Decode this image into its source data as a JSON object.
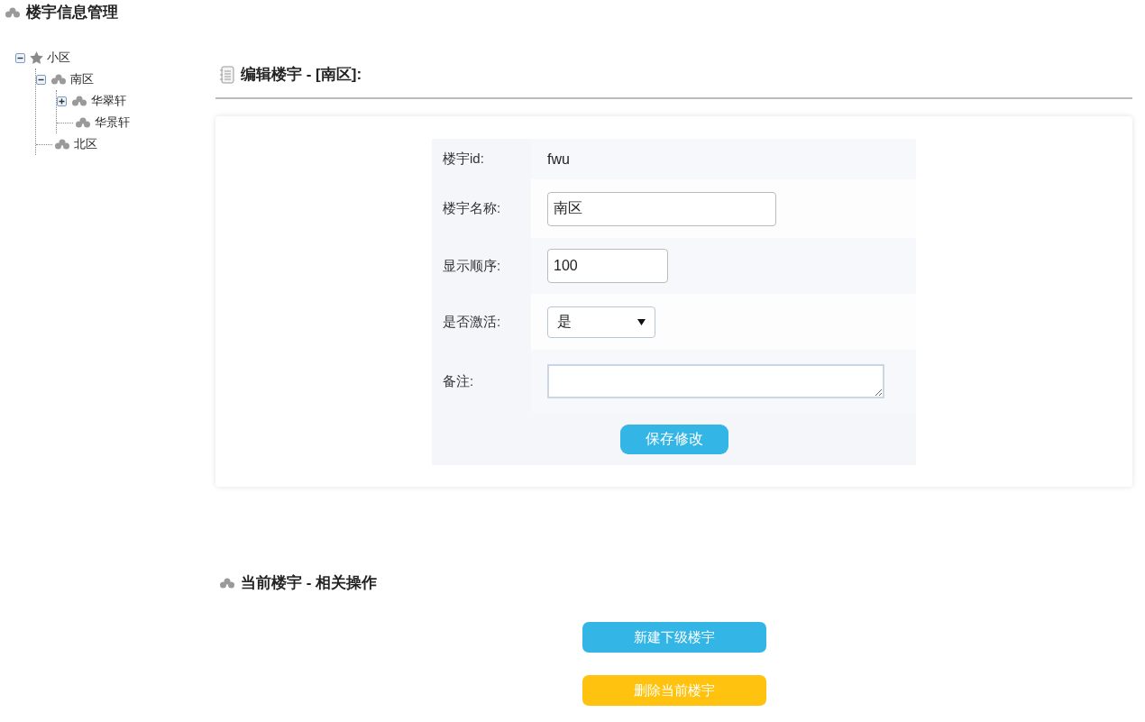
{
  "page_title": "楼宇信息管理",
  "tree": [
    {
      "label": "小区",
      "kind": "root",
      "expanded": true,
      "children": [
        {
          "label": "南区",
          "kind": "building",
          "expanded": true,
          "children": [
            {
              "label": "华翠轩",
              "kind": "building",
              "expanded": false
            },
            {
              "label": "华景轩",
              "kind": "building"
            }
          ]
        },
        {
          "label": "北区",
          "kind": "building"
        }
      ]
    }
  ],
  "edit_section": {
    "title": "编辑楼宇 - [南区]:",
    "fields": [
      {
        "kind": "text",
        "label": "楼宇id:",
        "value": "fwu"
      },
      {
        "kind": "input",
        "label": "楼宇名称:",
        "value": "南区"
      },
      {
        "kind": "short_input",
        "label": "显示顺序:",
        "value": "100"
      },
      {
        "kind": "select",
        "label": "是否激活:",
        "value": "是"
      },
      {
        "kind": "textarea",
        "label": "备注:"
      }
    ],
    "save_button": "保存修改"
  },
  "actions_section": {
    "title": "当前楼宇 - 相关操作",
    "buttons": [
      {
        "label": "新建下级楼宇",
        "kind": "primary"
      },
      {
        "label": "删除当前楼宇",
        "kind": "warning"
      }
    ]
  }
}
